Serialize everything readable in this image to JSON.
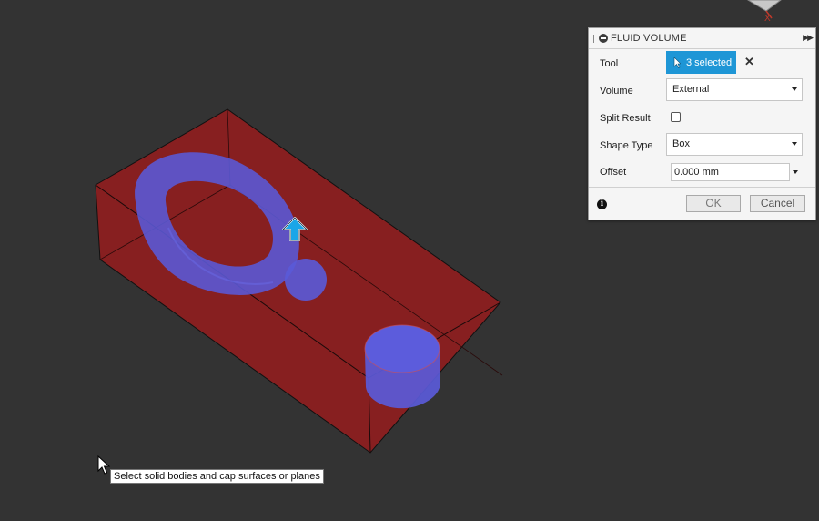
{
  "dialog": {
    "title": "FLUID VOLUME",
    "tool": {
      "label": "Tool",
      "selection": "3 selected"
    },
    "volume": {
      "label": "Volume",
      "value": "External"
    },
    "split_result": {
      "label": "Split Result",
      "checked": false
    },
    "shape_type": {
      "label": "Shape Type",
      "value": "Box"
    },
    "offset": {
      "label": "Offset",
      "value": "0.000 mm"
    },
    "ok_label": "OK",
    "cancel_label": "Cancel"
  },
  "viewcube": {
    "axis_label": "X"
  },
  "tooltip": "Select solid bodies and cap surfaces or planes",
  "colors": {
    "viewport_bg": "#333333",
    "box_fill": "#8a1f20",
    "body_fill": "#5858dc",
    "accent": "#1e96d6"
  }
}
